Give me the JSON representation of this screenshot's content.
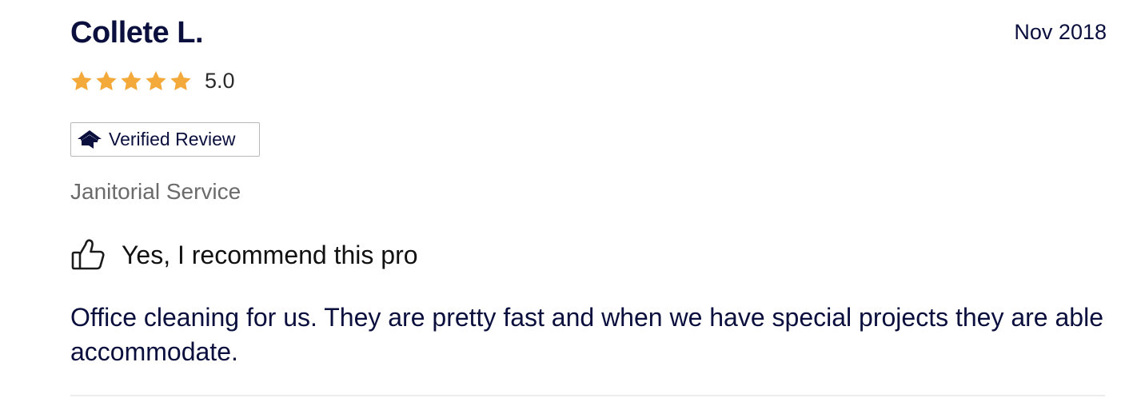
{
  "review": {
    "reviewer_name": "Collete L.",
    "date": "Nov 2018",
    "rating": {
      "stars": 5,
      "max_stars": 5,
      "value_label": "5.0",
      "star_color": "#f4a93b"
    },
    "badge": {
      "label": "Verified Review",
      "icon": "house-icon"
    },
    "service": "Janitorial Service",
    "recommendation": {
      "icon": "thumbs-up-icon",
      "label": "Yes, I recommend this pro"
    },
    "text": "Office cleaning for us. They are pretty fast and when we have special projects they are able accommodate."
  },
  "colors": {
    "primary_text": "#0a0f3d",
    "secondary_text": "#6b6b6b"
  }
}
